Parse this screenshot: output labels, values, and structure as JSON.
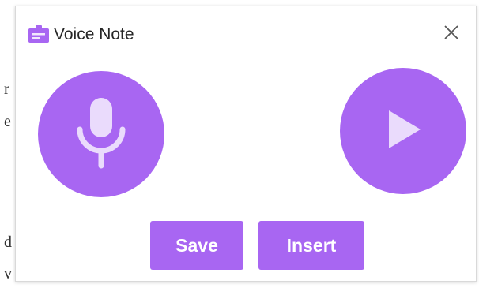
{
  "background_fragments": [
    "r",
    "e",
    "d",
    "v"
  ],
  "dialog": {
    "title": "Voice Note",
    "app_icon": "voice-note-app-icon",
    "close_icon": "close-icon",
    "record_icon": "microphone-icon",
    "play_icon": "play-icon",
    "save_label": "Save",
    "insert_label": "Insert"
  },
  "colors": {
    "accent": "#a866f2",
    "accent_light": "#eadbfc",
    "text": "#262626",
    "close": "#555555"
  }
}
